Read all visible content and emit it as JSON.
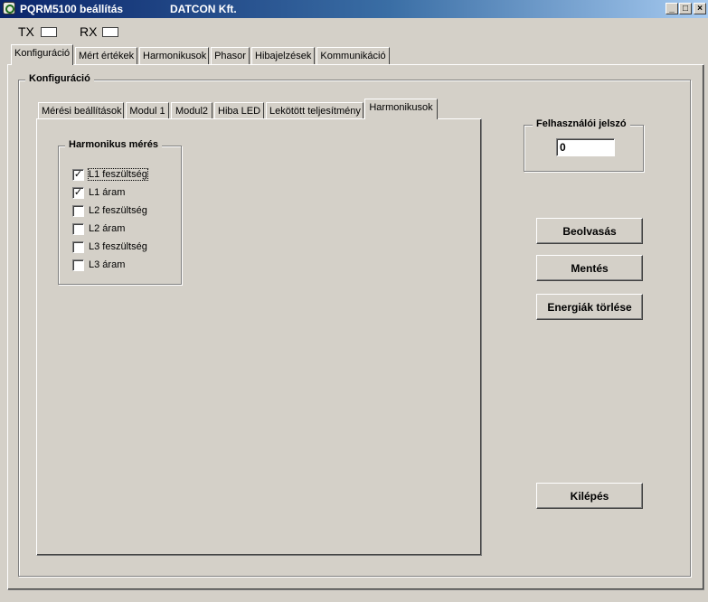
{
  "window": {
    "title": "PQRM5100 beállítás",
    "company": "DATCON Kft.",
    "minimize_glyph": "_",
    "maximize_glyph": "□",
    "close_glyph": "×"
  },
  "indicators": {
    "tx_label": "TX",
    "rx_label": "RX"
  },
  "main_tabs": [
    {
      "label": "Konfiguráció",
      "active": true
    },
    {
      "label": "Mért értékek",
      "active": false
    },
    {
      "label": "Harmonikusok",
      "active": false
    },
    {
      "label": "Phasor",
      "active": false
    },
    {
      "label": "Hibajelzések",
      "active": false
    },
    {
      "label": "Kommunikáció",
      "active": false
    }
  ],
  "config_group": {
    "title": "Konfiguráció"
  },
  "sub_tabs": [
    {
      "label": "Mérési beállítások",
      "active": false
    },
    {
      "label": "Modul 1",
      "active": false
    },
    {
      "label": "Modul2",
      "active": false
    },
    {
      "label": "Hiba LED",
      "active": false
    },
    {
      "label": "Lekötött teljesítmény",
      "active": false
    },
    {
      "label": "Harmonikusok",
      "active": true
    }
  ],
  "harmonic_group": {
    "title": "Harmonikus mérés",
    "items": [
      {
        "label": "L1 feszültség",
        "checked": true,
        "mark": "✓"
      },
      {
        "label": "L1 áram",
        "checked": true,
        "mark": "✓"
      },
      {
        "label": "L2 feszültség",
        "checked": false,
        "mark": ""
      },
      {
        "label": "L2 áram",
        "checked": false,
        "mark": ""
      },
      {
        "label": "L3 feszültség",
        "checked": false,
        "mark": ""
      },
      {
        "label": "L3 áram",
        "checked": false,
        "mark": ""
      }
    ]
  },
  "password": {
    "title": "Felhasználói jelszó",
    "value": "0"
  },
  "buttons": {
    "read": "Beolvasás",
    "save": "Mentés",
    "clear_energy": "Energiák törlése",
    "exit": "Kilépés"
  }
}
